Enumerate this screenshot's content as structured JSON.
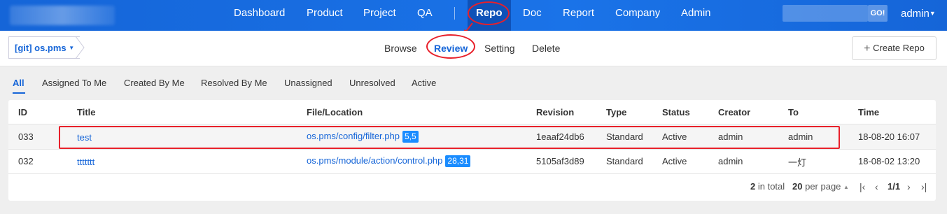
{
  "nav": {
    "items": [
      "Dashboard",
      "Product",
      "Project",
      "QA",
      "Repo",
      "Doc",
      "Report",
      "Company",
      "Admin"
    ],
    "search_button": "GO!",
    "user_menu": "admin"
  },
  "repo": {
    "switcher_label": "[git] os.pms"
  },
  "subnav": {
    "items": [
      "Browse",
      "Review",
      "Setting",
      "Delete"
    ],
    "create_label": "Create Repo"
  },
  "filters": {
    "items": [
      "All",
      "Assigned To Me",
      "Created By Me",
      "Resolved By Me",
      "Unassigned",
      "Unresolved",
      "Active"
    ]
  },
  "table": {
    "headers": [
      "ID",
      "Title",
      "File/Location",
      "Revision",
      "Type",
      "Status",
      "Creator",
      "To",
      "Time"
    ],
    "rows": [
      {
        "id": "033",
        "title": "test",
        "file": "os.pms/config/filter.php",
        "loc": "5,5",
        "revision": "1eaaf24db6",
        "type": "Standard",
        "status": "Active",
        "creator": "admin",
        "to": "admin",
        "time": "18-08-20 16:07"
      },
      {
        "id": "032",
        "title": "ttttttt",
        "file": "os.pms/module/action/control.php",
        "loc": "28,31",
        "revision": "5105af3d89",
        "type": "Standard",
        "status": "Active",
        "creator": "admin",
        "to": "一灯",
        "time": "18-08-02 13:20"
      }
    ]
  },
  "pager": {
    "total": "2",
    "total_suffix": "in total",
    "per_page": "20",
    "per_page_suffix": "per page",
    "page": "1/1"
  },
  "colors": {
    "primary": "#1565d8",
    "highlight": "#e8202a"
  }
}
